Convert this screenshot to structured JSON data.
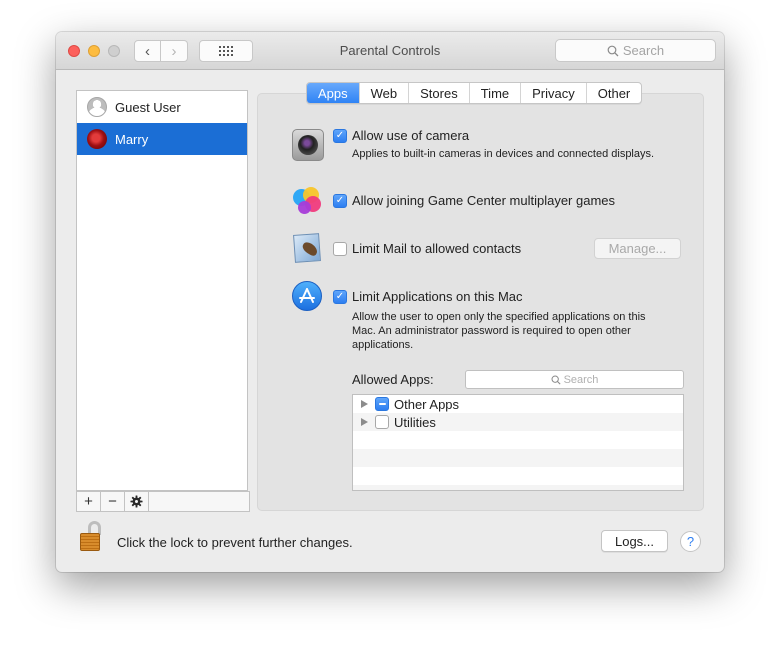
{
  "window": {
    "title": "Parental Controls",
    "search_placeholder": "Search"
  },
  "toolbar": {
    "back_icon": "chevron-left",
    "forward_icon": "chevron-right",
    "show_all_icon": "grid-dots"
  },
  "sidebar": {
    "users": [
      {
        "name": "Guest User",
        "avatar": "guest-silhouette",
        "selected": false
      },
      {
        "name": "Marry",
        "avatar": "red-rose",
        "selected": true
      }
    ],
    "tools": {
      "add": "+",
      "remove": "−",
      "settings_icon": "gear"
    }
  },
  "tabs": [
    {
      "label": "Apps",
      "active": true
    },
    {
      "label": "Web",
      "active": false
    },
    {
      "label": "Stores",
      "active": false
    },
    {
      "label": "Time",
      "active": false
    },
    {
      "label": "Privacy",
      "active": false
    },
    {
      "label": "Other",
      "active": false
    }
  ],
  "settings": {
    "camera": {
      "label": "Allow use of camera",
      "checked": true,
      "description": "Applies to built-in cameras in devices and connected displays."
    },
    "game_center": {
      "label": "Allow joining Game Center multiplayer games",
      "checked": true
    },
    "mail": {
      "label": "Limit Mail to allowed contacts",
      "checked": false,
      "manage_button": "Manage..."
    },
    "limit_apps": {
      "label": "Limit Applications on this Mac",
      "checked": true,
      "description_lines": [
        "Allow the user to open only the specified applications on this",
        "Mac. An administrator password is required to open other",
        "applications."
      ]
    }
  },
  "allowed_apps": {
    "label": "Allowed Apps:",
    "search_placeholder": "Search",
    "items": [
      {
        "name": "Other Apps",
        "state": "mixed"
      },
      {
        "name": "Utilities",
        "state": "unchecked"
      }
    ]
  },
  "footer": {
    "lock_text": "Click the lock to prevent further changes.",
    "logs_button": "Logs...",
    "help_button": "?"
  },
  "colors": {
    "accent": "#2f83f5",
    "selection": "#1b6ed5"
  }
}
